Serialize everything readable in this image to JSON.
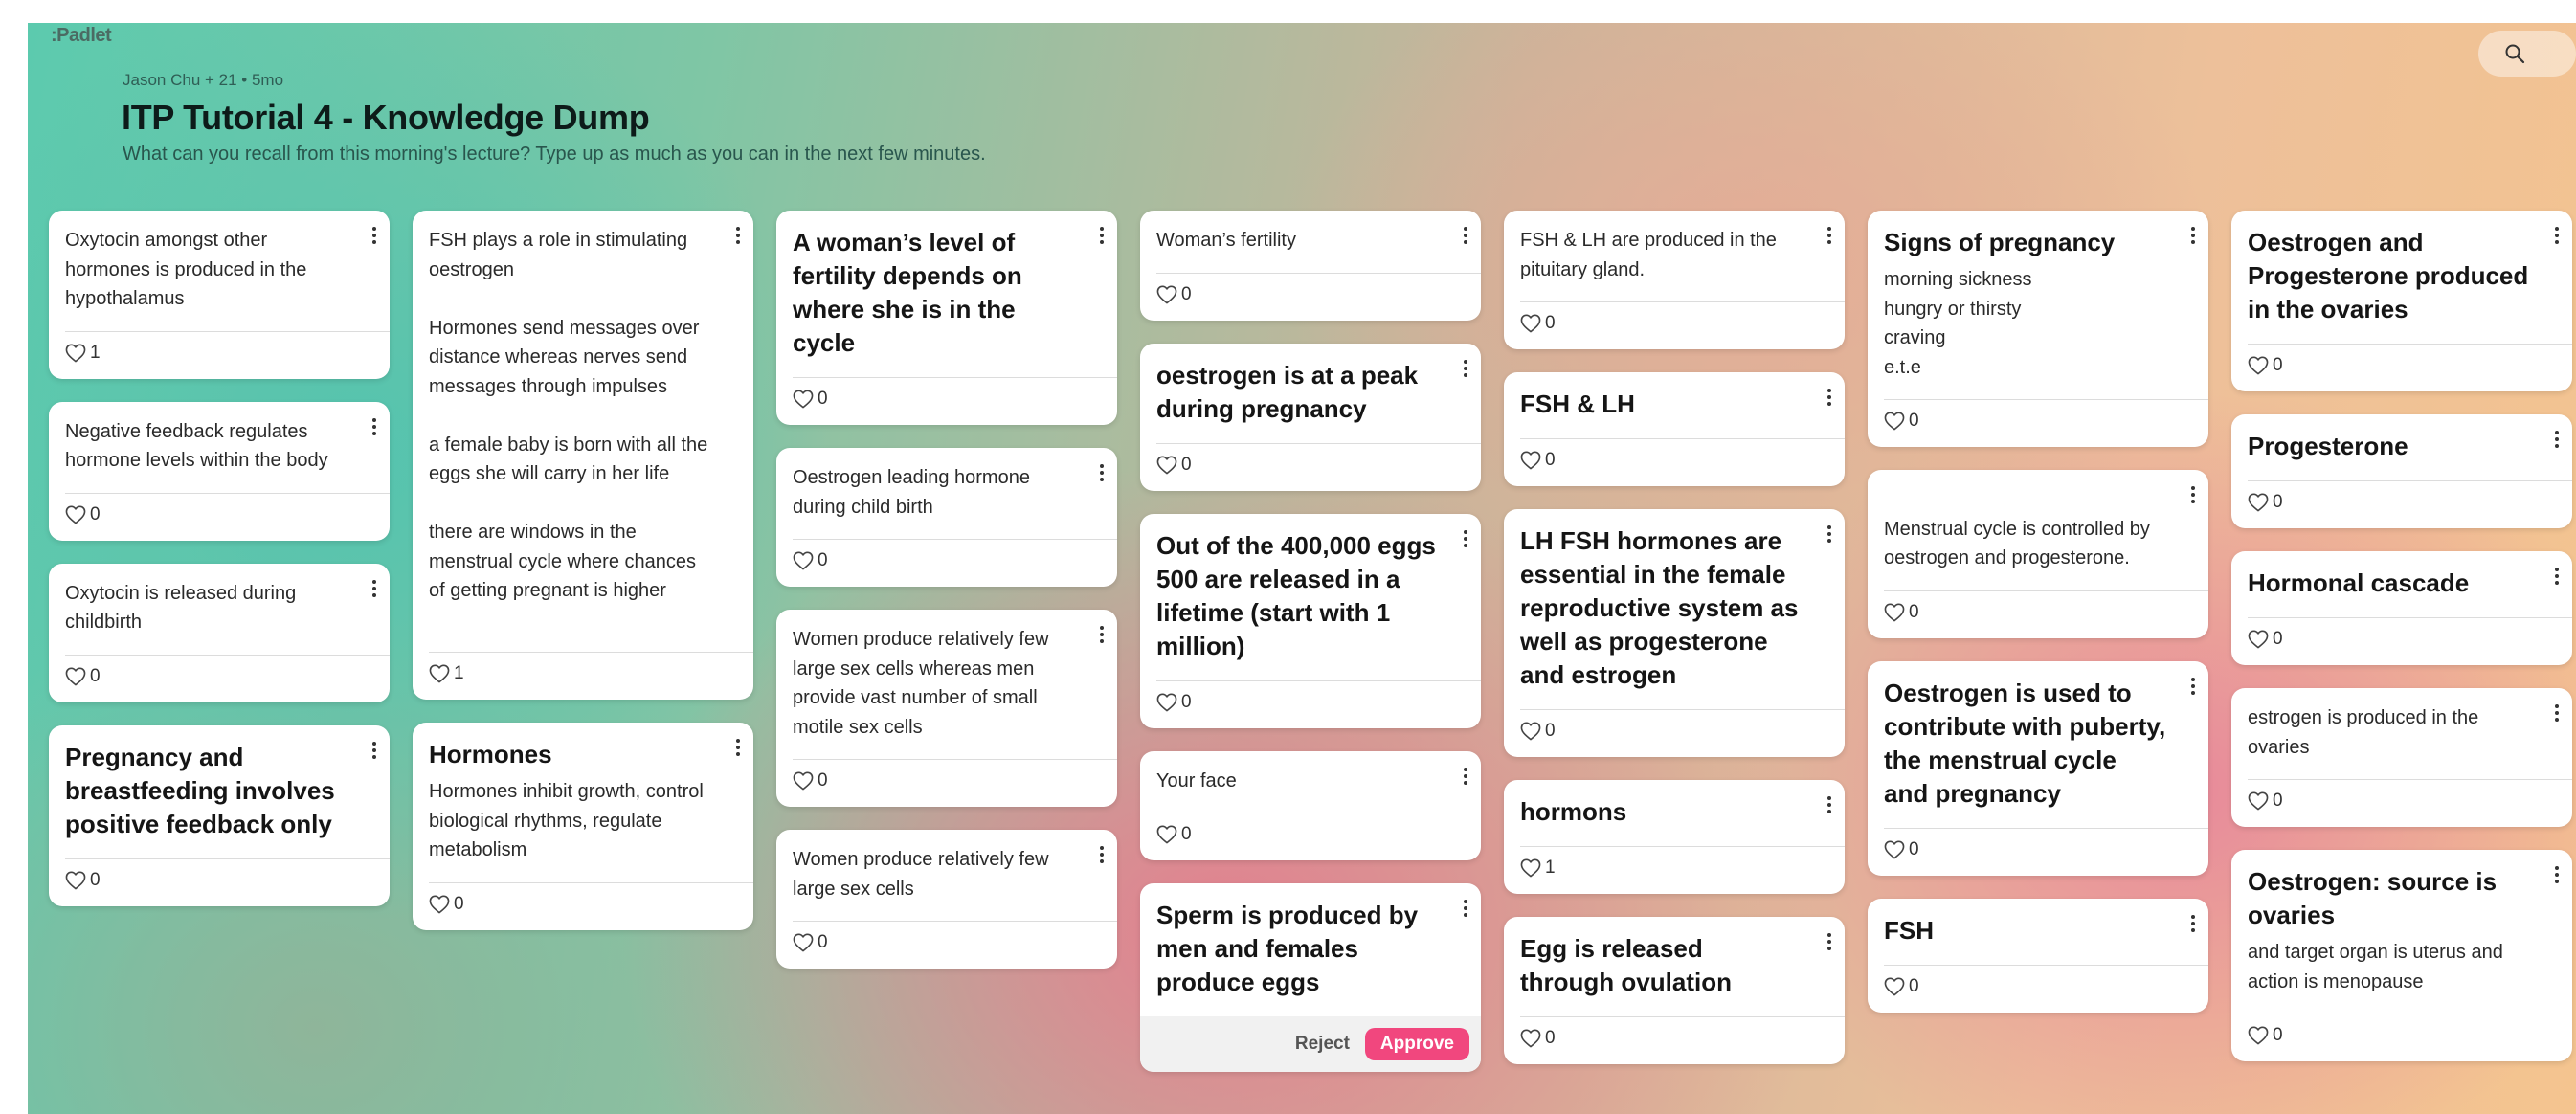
{
  "app": {
    "logo": ":Padlet"
  },
  "header": {
    "meta": "Jason Chu + 21 • 5mo",
    "title": "ITP Tutorial 4 - Knowledge Dump",
    "subtitle": "What can you recall from this morning's lecture? Type up as much as you can in the next few minutes."
  },
  "icons": {
    "search": "search-icon",
    "more": "more-vertical-icon",
    "like": "heart-icon"
  },
  "colors": {
    "approve": "#f1477e",
    "card": "#ffffff"
  },
  "moderation": {
    "reject_label": "Reject",
    "approve_label": "Approve"
  },
  "columns": [
    {
      "posts": [
        {
          "subject": "",
          "body": "Oxytocin amongst other hormones is produced in the hypothalamus",
          "likes": "1"
        },
        {
          "subject": "",
          "body": "Negative feedback regulates hormone levels within the body",
          "likes": "0"
        },
        {
          "subject": "",
          "body": "Oxytocin is released during childbirth",
          "likes": "0"
        },
        {
          "subject": "Pregnancy and breastfeeding involves positive feedback only",
          "body": "",
          "likes": "0"
        }
      ]
    },
    {
      "posts": [
        {
          "subject": "",
          "body": "FSH plays a role in stimulating oestrogen\n\nHormones send messages over distance whereas nerves send messages through impulses\n\na female baby is born with all the eggs she will carry in her life\n\nthere are windows in the menstrual cycle where chances of getting pregnant is higher\n\n",
          "likes": "1"
        },
        {
          "subject": "Hormones",
          "body": "Hormones inhibit growth, control biological rhythms, regulate metabolism",
          "likes": "0"
        }
      ]
    },
    {
      "posts": [
        {
          "subject": "A woman’s level of fertility depends on where she is in the cycle",
          "body": "",
          "likes": "0"
        },
        {
          "subject": "",
          "body": "Oestrogen leading hormone during child birth",
          "likes": "0"
        },
        {
          "subject": "",
          "body": "Women produce relatively few large sex cells whereas men provide vast number of small motile sex cells",
          "likes": "0"
        },
        {
          "subject": "",
          "body": "Women produce relatively few large sex cells",
          "likes": "0"
        }
      ]
    },
    {
      "posts": [
        {
          "subject": "",
          "body": "Woman’s fertility",
          "likes": "0"
        },
        {
          "subject": "oestrogen is at a peak during pregnancy",
          "body": "",
          "likes": "0"
        },
        {
          "subject": "Out of the 400,000 eggs 500 are released in a lifetime (start with 1 million)",
          "body": "",
          "likes": "0"
        },
        {
          "subject": "",
          "body": "Your face",
          "likes": "0"
        },
        {
          "subject": "Sperm is produced by men and females produce eggs",
          "body": "",
          "likes": "",
          "pending": true
        }
      ]
    },
    {
      "posts": [
        {
          "subject": "",
          "body": "FSH & LH are produced in the pituitary gland.",
          "likes": "0"
        },
        {
          "subject": "FSH & LH",
          "body": "",
          "likes": "0"
        },
        {
          "subject": "LH FSH hormones are essential in the female reproductive system as well as progesterone and estrogen",
          "body": "",
          "likes": "0"
        },
        {
          "subject": "hormons",
          "body": "",
          "likes": "1"
        },
        {
          "subject": "Egg is released through ovulation",
          "body": "",
          "likes": "0"
        }
      ]
    },
    {
      "posts": [
        {
          "subject": "Signs of pregnancy",
          "body": "morning sickness\nhungry or thirsty\ncraving\ne.t.e",
          "likes": "0"
        },
        {
          "subject": "",
          "body": "\nMenstrual cycle is controlled by oestrogen and progesterone.",
          "likes": "0"
        },
        {
          "subject": "Oestrogen is used to contribute with puberty, the menstrual cycle and pregnancy",
          "body": "",
          "likes": "0"
        },
        {
          "subject": "FSH",
          "body": "",
          "likes": "0"
        }
      ]
    },
    {
      "posts": [
        {
          "subject": "Oestrogen and Progesterone produced in the ovaries",
          "body": "",
          "likes": "0"
        },
        {
          "subject": "Progesterone",
          "body": "",
          "likes": "0"
        },
        {
          "subject": "Hormonal cascade",
          "body": "",
          "likes": "0"
        },
        {
          "subject": "",
          "body": "estrogen is produced in the ovaries",
          "likes": "0"
        },
        {
          "subject": "Oestrogen: source is ovaries",
          "body": "and target organ is uterus and action is menopause",
          "likes": "0"
        }
      ]
    }
  ]
}
